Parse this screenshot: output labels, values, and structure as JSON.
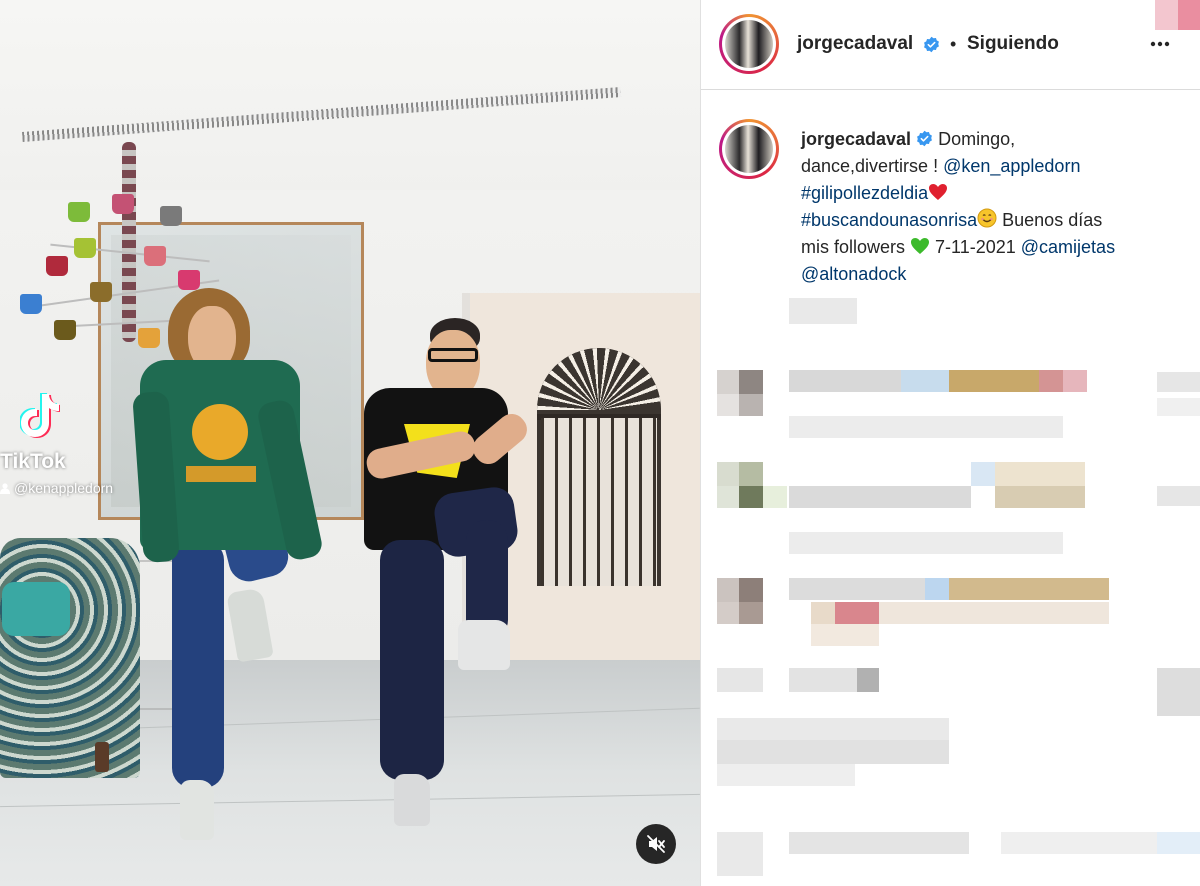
{
  "post": {
    "username": "jorgecadaval",
    "separator": "•",
    "follow_status": "Siguiendo",
    "more_icon": "ellipsis-icon",
    "verified_icon": "verified-badge-icon",
    "caption": {
      "text_1": "Domingo,",
      "text_2": "dance,divertirse ! ",
      "mention_1": "@ken_appledorn",
      "hashtag_1": "#gilipollezdeldia",
      "hashtag_2": "#buscandounasonrisa",
      "text_3": " Buenos días",
      "text_4": "mis followers ",
      "date": " 7-11-2021 ",
      "mention_2": "@camijetas",
      "mention_3": "@altonadock",
      "emoji_heart": "red-heart-icon",
      "emoji_smile": "smiling-face-icon",
      "emoji_green_heart": "green-heart-icon"
    }
  },
  "video": {
    "watermark_brand": "TikTok",
    "watermark_handle": "@kenappledorn",
    "mute_icon": "speaker-muted-icon"
  },
  "colors": {
    "link": "#00376b",
    "verified": "#3897f0",
    "text": "#262626"
  }
}
